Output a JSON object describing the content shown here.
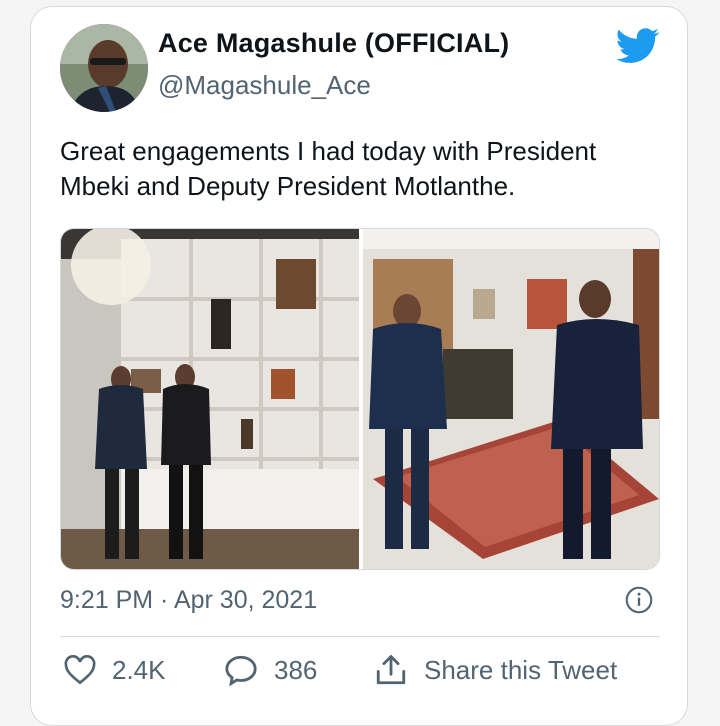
{
  "tweet": {
    "author_name": "Ace Magashule (OFFICIAL)",
    "handle": "@Magashule_Ace",
    "text": "Great engagements I had today with President\nMbeki and Deputy President Motlanthe.",
    "timestamp": "9:21 PM · Apr 30, 2021",
    "likes": "2.4K",
    "replies": "386",
    "share_label": "Share this Tweet"
  },
  "icons": {
    "brand": "twitter-bird-icon",
    "info": "info-icon",
    "like": "heart-icon",
    "reply": "reply-bubble-icon",
    "share": "share-upload-icon"
  },
  "colors": {
    "brand_blue": "#1d9bf0",
    "secondary_text": "#536471",
    "divider": "#cfd9de"
  }
}
